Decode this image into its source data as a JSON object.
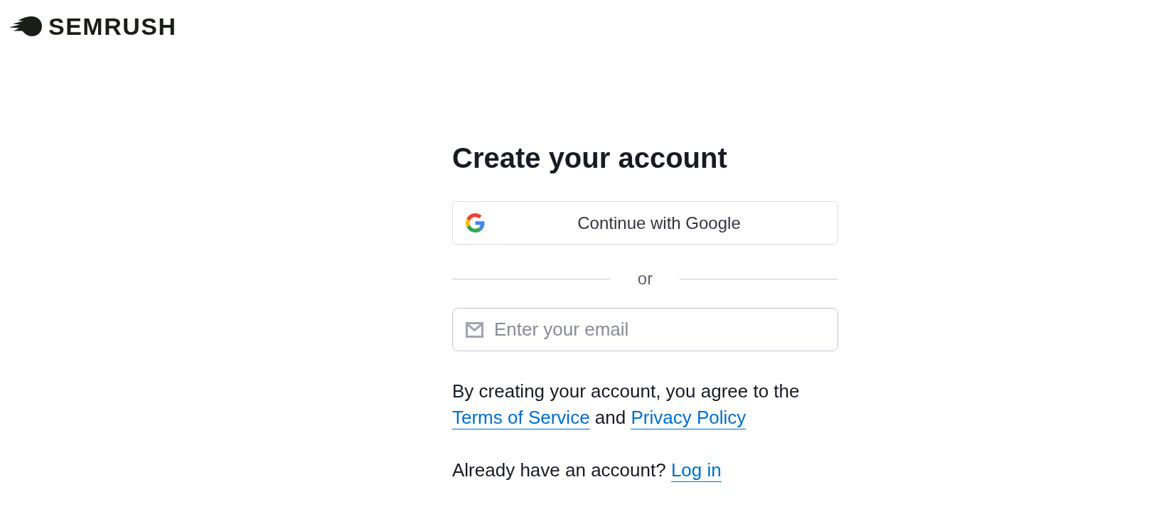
{
  "header": {
    "logo": {
      "text": "SEMRUSH"
    }
  },
  "form": {
    "title": "Create your account",
    "google_button": {
      "label": "Continue with Google"
    },
    "divider": {
      "label": "or"
    },
    "email_field": {
      "placeholder": "Enter your email"
    },
    "terms": {
      "parts": [
        {
          "kind": "text",
          "text": "By creating your account, you agree to the"
        },
        {
          "kind": "link",
          "text": "Terms of Service"
        },
        {
          "kind": "text",
          "text": "and"
        },
        {
          "kind": "link",
          "text": "Privacy Policy"
        }
      ]
    },
    "login_prompt": {
      "text": "Already have an account?",
      "link": "Log in"
    }
  }
}
